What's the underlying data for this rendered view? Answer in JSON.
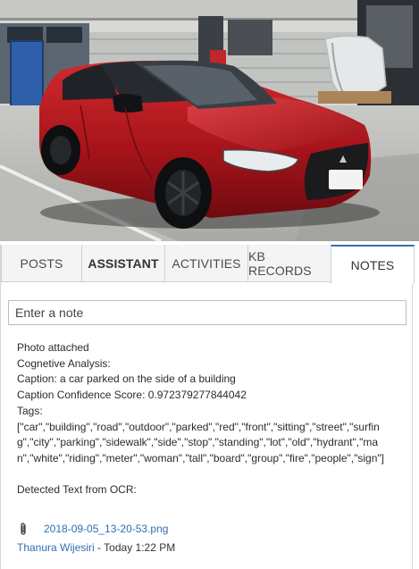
{
  "photo": {
    "alt": "red car photo"
  },
  "tabs": [
    {
      "label": "POSTS"
    },
    {
      "label": "ASSISTANT"
    },
    {
      "label": "ACTIVITIES"
    },
    {
      "label": "KB RECORDS"
    },
    {
      "label": "NOTES"
    }
  ],
  "active_tab": "NOTES",
  "note_input": {
    "placeholder": "Enter a note",
    "value": ""
  },
  "note": {
    "line1": "Photo attached",
    "line2": "Cognetive Analysis:",
    "line3": "Caption: a car parked on the side of a building",
    "line4": "Caption Confidence Score: 0.972379277844042",
    "line5": "Tags:",
    "tags": "[\"car\",\"building\",\"road\",\"outdoor\",\"parked\",\"red\",\"front\",\"sitting\",\"street\",\"surfing\",\"city\",\"parking\",\"sidewalk\",\"side\",\"stop\",\"standing\",\"lot\",\"old\",\"hydrant\",\"man\",\"white\",\"riding\",\"meter\",\"woman\",\"tall\",\"board\",\"group\",\"fire\",\"people\",\"sign\"]",
    "ocr_heading": "Detected Text from OCR:"
  },
  "attachment": {
    "icon": "paperclip-icon",
    "filename": "2018-09-05_13-20-53.png"
  },
  "meta": {
    "author": "Thanura Wijesiri",
    "separator": "-",
    "time": "Today 1:22 PM"
  },
  "colors": {
    "accent": "#2f6fb3",
    "car": "#b3161c"
  }
}
